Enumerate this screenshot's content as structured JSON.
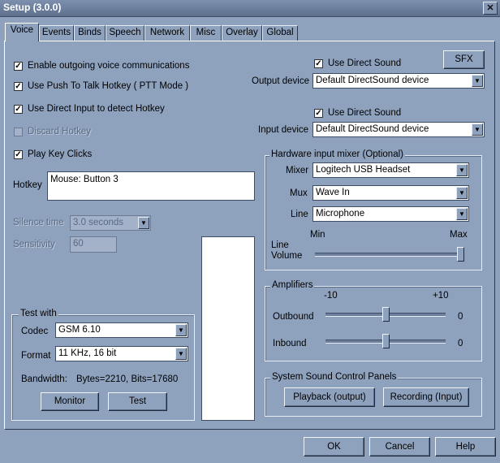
{
  "window": {
    "title": "Setup (3.0.0)",
    "close_label": "✕"
  },
  "tabs": [
    {
      "label": "Voice"
    },
    {
      "label": "Events"
    },
    {
      "label": "Binds"
    },
    {
      "label": "Speech"
    },
    {
      "label": "Network"
    },
    {
      "label": "Misc"
    },
    {
      "label": "Overlay"
    },
    {
      "label": "Global"
    }
  ],
  "voice": {
    "enable_outgoing": "Enable outgoing voice communications",
    "push_to_talk": "Use Push To Talk Hotkey ( PTT Mode )",
    "direct_input": "Use Direct Input to detect Hotkey",
    "discard_hotkey": "Discard Hotkey",
    "play_key_clicks": "Play Key Clicks",
    "hotkey_label": "Hotkey",
    "hotkey_value": "Mouse: Button 3",
    "silence_label": "Silence time",
    "silence_value": "3.0 seconds",
    "sensitivity_label": "Sensitivity",
    "sensitivity_value": "60"
  },
  "test_with": {
    "title": "Test with",
    "codec_label": "Codec",
    "codec_value": "GSM 6.10",
    "format_label": "Format",
    "format_value": "11 KHz, 16 bit",
    "bandwidth_label": "Bandwidth:",
    "bandwidth_value": "Bytes=2210, Bits=17680",
    "monitor_button": "Monitor",
    "test_button": "Test"
  },
  "output": {
    "sfx_button": "SFX",
    "use_direct_sound": "Use Direct Sound",
    "device_label": "Output device",
    "device_value": "Default DirectSound device"
  },
  "input": {
    "use_direct_sound": "Use Direct Sound",
    "device_label": "Input device",
    "device_value": "Default DirectSound device"
  },
  "mixer": {
    "title": "Hardware input mixer (Optional)",
    "mixer_label": "Mixer",
    "mixer_value": "Logitech USB Headset",
    "mux_label": "Mux",
    "mux_value": "Wave In",
    "line_label": "Line",
    "line_value": "Microphone",
    "min_label": "Min",
    "max_label": "Max",
    "line_volume_label_1": "Line",
    "line_volume_label_2": "Volume",
    "line_volume_level": 1.0
  },
  "amplifiers": {
    "title": "Amplifiers",
    "min_label": "-10",
    "max_label": "+10",
    "outbound_label": "Outbound",
    "outbound_value": "0",
    "outbound_level": 0.5,
    "inbound_label": "Inbound",
    "inbound_value": "0",
    "inbound_level": 0.5
  },
  "system_sound": {
    "title": "System Sound Control Panels",
    "playback_button": "Playback (output)",
    "recording_button": "Recording (Input)"
  },
  "footer": {
    "ok": "OK",
    "cancel": "Cancel",
    "help": "Help"
  },
  "check_glyph": "✓",
  "arrow_glyph": "▼"
}
